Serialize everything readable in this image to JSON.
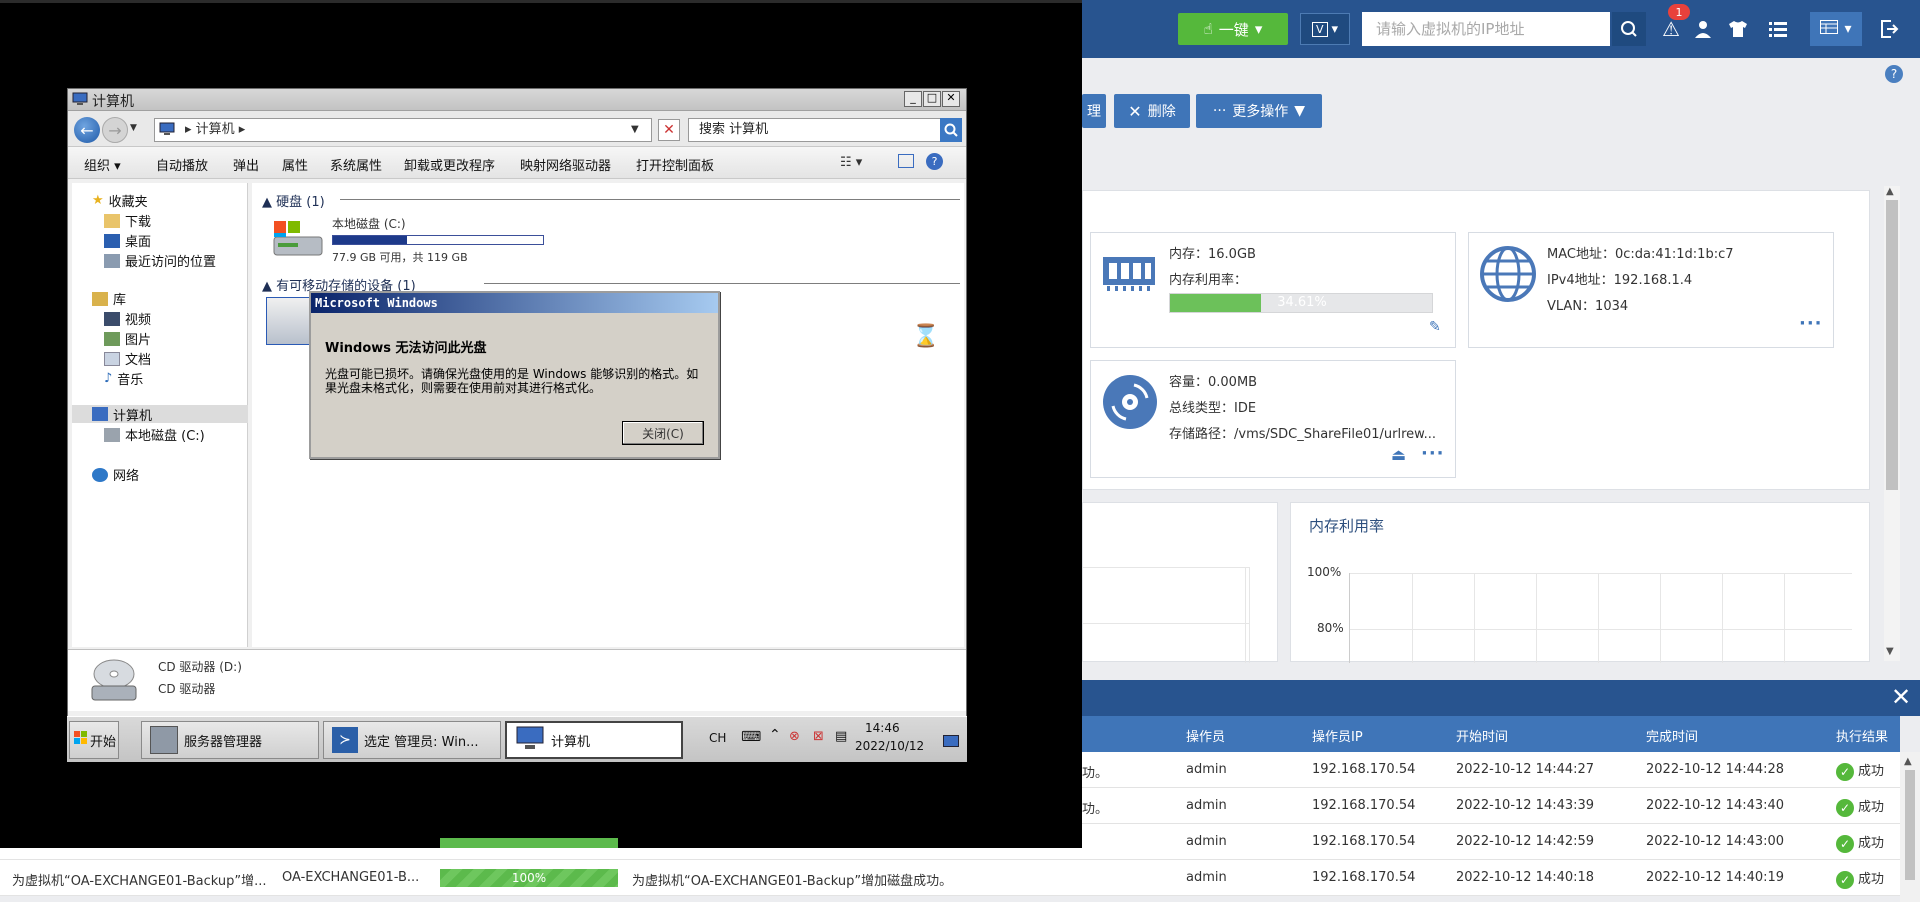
{
  "console": {
    "oneclick_label": "一键",
    "v_label": "V",
    "search_placeholder": "请输入虚拟机的IP地址",
    "alert_count": "1",
    "toolbar": {
      "manage_label": "理",
      "delete_label": "删除",
      "more_label": "更多操作"
    },
    "memory_card": {
      "memory_label": "内存：16.0GB",
      "usage_label": "内存利用率：",
      "usage_value": "34.61%",
      "usage_fraction": 0.3461
    },
    "network_card": {
      "mac": "MAC地址：0c:da:41:1d:1b:c7",
      "ipv4": "IPv4地址：192.168.1.4",
      "vlan": "VLAN：1034"
    },
    "disk_card": {
      "capacity": "容量：0.00MB",
      "bus": "总线类型：IDE",
      "path": "存储路径：/vms/SDC_ShareFile01/urlrew..."
    },
    "memory_chart": {
      "title": "内存利用率",
      "tick_100": "100%",
      "tick_80": "80%"
    }
  },
  "tasks": {
    "columns": [
      "操作员",
      "操作员IP",
      "开始时间",
      "完成时间",
      "执行结果"
    ],
    "rows": [
      {
        "desc": "功。",
        "op": "admin",
        "ip": "192.168.170.54",
        "start": "2022-10-12 14:44:27",
        "end": "2022-10-12 14:44:28",
        "result": "成功"
      },
      {
        "desc": "功。",
        "op": "admin",
        "ip": "192.168.170.54",
        "start": "2022-10-12 14:43:39",
        "end": "2022-10-12 14:43:40",
        "result": "成功"
      },
      {
        "desc": "",
        "op": "admin",
        "ip": "192.168.170.54",
        "start": "2022-10-12 14:42:59",
        "end": "2022-10-12 14:43:00",
        "result": "成功"
      },
      {
        "task": "为虚拟机“OA-EXCHANGE01-Backup”增...",
        "object": "OA-EXCHANGE01-B...",
        "progress": "100%",
        "desc": "为虚拟机“OA-EXCHANGE01-Backup”增加磁盘成功。",
        "op": "admin",
        "ip": "192.168.170.54",
        "start": "2022-10-12 14:40:18",
        "end": "2022-10-12 14:40:19",
        "result": "成功"
      }
    ]
  },
  "explorer": {
    "title": "计算机",
    "address": "▸ 计算机 ▸",
    "search": "搜索 计算机",
    "commands": [
      "组织 ▾",
      "自动播放",
      "弹出",
      "属性",
      "系统属性",
      "卸载或更改程序",
      "映射网络驱动器",
      "打开控制面板"
    ],
    "nav": {
      "favorites": "收藏夹",
      "downloads": "下载",
      "desktop": "桌面",
      "recent": "最近访问的位置",
      "libraries": "库",
      "videos": "视频",
      "pictures": "图片",
      "documents": "文档",
      "music": "音乐",
      "computer": "计算机",
      "local_disk": "本地磁盘 (C:)",
      "network": "网络"
    },
    "hdd_group": "硬盘 (1)",
    "drive_name": "本地磁盘 (C:)",
    "drive_info": "77.9 GB 可用，共 119 GB",
    "drive_used_fraction": 0.35,
    "removable_group": "有可移动存储的设备 (1)",
    "details_name": "CD 驱动器 (D:)",
    "details_type": "CD 驱动器"
  },
  "dialog": {
    "title": "Microsoft Windows",
    "heading": "Windows 无法访问此光盘",
    "body": "光盘可能已损坏。请确保光盘使用的是 Windows 能够识别的格式。如果光盘未格式化，则需要在使用前对其进行格式化。",
    "close_label": "关闭(C)"
  },
  "taskbar": {
    "start": "开始",
    "tasks": [
      "服务器管理器",
      "选定 管理员: Win...",
      "计算机"
    ],
    "lang": "CH",
    "time": "14:46",
    "date": "2022/10/12"
  }
}
